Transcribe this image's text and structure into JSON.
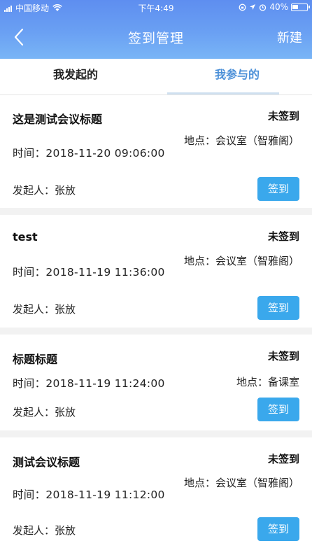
{
  "statusbar": {
    "carrier": "中国移动",
    "time": "下午4:49",
    "battery": "40%"
  },
  "navbar": {
    "title": "签到管理",
    "new_label": "新建"
  },
  "tabs": [
    {
      "label": "我发起的"
    },
    {
      "label": "我参与的"
    }
  ],
  "meetings": [
    {
      "title": "这是测试会议标题",
      "status": "未签到",
      "time": "时间：2018-11-20 09:06:00",
      "location": "地点：会议室（智雅阁）",
      "initiator": "发起人：张放",
      "button": "签到"
    },
    {
      "title": "test",
      "status": "未签到",
      "time": "时间：2018-11-19 11:36:00",
      "location": "地点：会议室（智雅阁）",
      "initiator": "发起人：张放",
      "button": "签到"
    },
    {
      "title": "标题标题",
      "status": "未签到",
      "time": "时间：2018-11-19 11:24:00",
      "location": "地点：备课室",
      "initiator": "发起人：张放",
      "button": "签到"
    },
    {
      "title": "测试会议标题",
      "status": "未签到",
      "time": "时间：2018-11-19 11:12:00",
      "location": "地点：会议室（智雅阁）",
      "initiator": "发起人：张放",
      "button": "签到"
    }
  ],
  "colors": {
    "header": "#6aa0f3",
    "active_tab": "#4a8fd8",
    "button": "#3aa8ec"
  }
}
